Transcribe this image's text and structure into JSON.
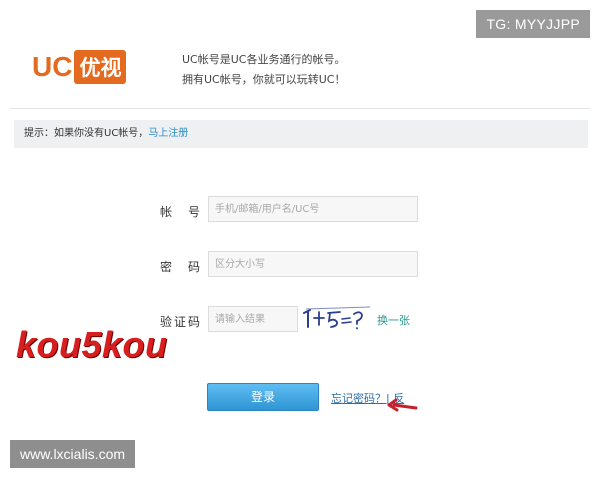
{
  "overlay": {
    "tg_tag": "TG: MYYJJPP",
    "site_tag": "www.lxcialis.com",
    "watermark": "kou5kou"
  },
  "header": {
    "logo_uc": "UC",
    "logo_cn": "优视",
    "desc_line1": "UC帐号是UC各业务通行的帐号。",
    "desc_line2": "拥有UC帐号，你就可以玩转UC！"
  },
  "tip": {
    "text": "提示：如果你没有UC帐号，",
    "link": "马上注册"
  },
  "form": {
    "account_label": "帐　号",
    "account_placeholder": "手机/邮箱/用户名/UC号",
    "password_label": "密　码",
    "password_placeholder": "区分大小写",
    "captcha_label": "验证码",
    "captcha_placeholder": "请输入结果",
    "captcha_text": "1+5=?",
    "refresh_label": "换一张",
    "login_button": "登录",
    "forgot_link": "忘记密码？| 反"
  },
  "colors": {
    "brand_orange": "#e36a1f",
    "button_blue": "#2f95d4",
    "link_blue": "#2a8ec9",
    "watermark_red": "#d71f1f",
    "tip_bg": "#eef0f1"
  }
}
